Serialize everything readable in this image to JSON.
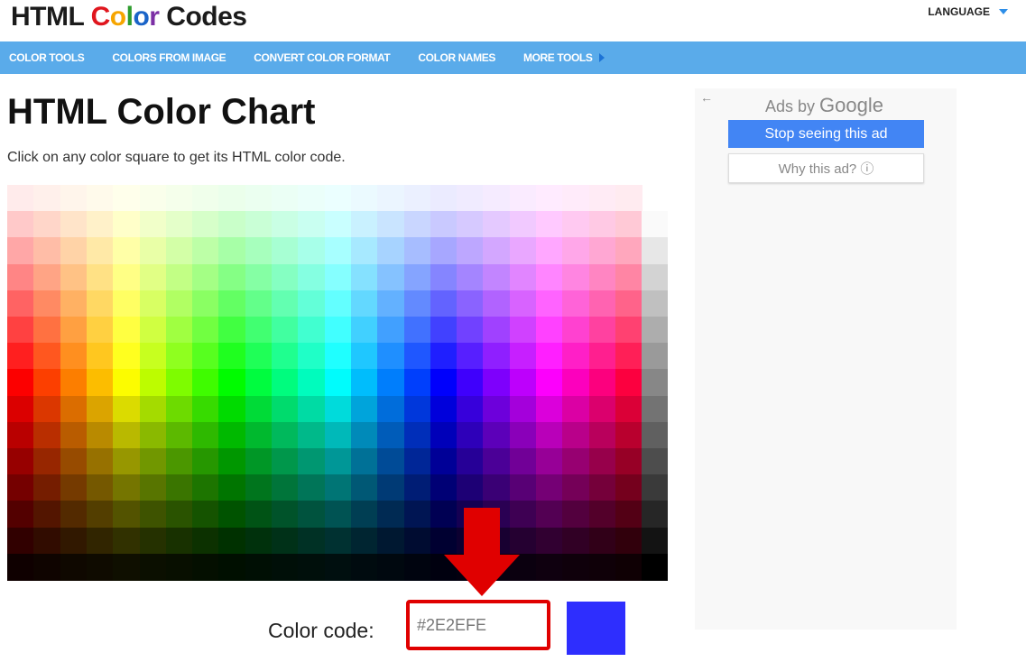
{
  "header": {
    "logo": {
      "part1": "HTML ",
      "letters": [
        "C",
        "o",
        "l",
        "o",
        "r"
      ],
      "letter_colors": [
        "#e0161e",
        "#f6a500",
        "#2e9c2e",
        "#1a64c8",
        "#7c2fa5"
      ],
      "part3": " Codes"
    },
    "language_label": "LANGUAGE"
  },
  "nav": {
    "items": [
      "COLOR TOOLS",
      "COLORS FROM IMAGE",
      "CONVERT COLOR FORMAT",
      "COLOR NAMES",
      "MORE TOOLS"
    ]
  },
  "main": {
    "title": "HTML Color Chart",
    "subtitle": "Click on any color square to get its HTML color code.",
    "color_code_label": "Color code:",
    "color_code_value": "#2E2EFE",
    "selected_swatch_color": "#2E2EFE",
    "chart": {
      "hue_columns": 24,
      "lightness_rows": 15,
      "gray_column": true
    }
  },
  "ad": {
    "back_glyph": "←",
    "ads_by": "Ads by",
    "google": "Google",
    "stop_label": "Stop seeing this ad",
    "why_label": "Why this ad? ⓘ"
  },
  "colors": {
    "nav_bg": "#5aabea",
    "annotation_red": "#e00000",
    "ad_button": "#4285f4"
  }
}
